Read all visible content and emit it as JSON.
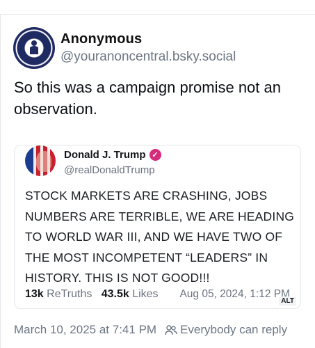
{
  "post": {
    "author_name": "Anonymous",
    "author_handle": "@youranoncentral.bsky.social",
    "text": "So this was a campaign promise not an observation."
  },
  "quote": {
    "author_name": "Donald J. Trump",
    "author_handle": "@realDonaldTrump",
    "text": "STOCK MARKETS ARE CRASHING, JOBS NUMBERS ARE TERRIBLE, WE ARE HEADING TO WORLD WAR III, AND WE HAVE TWO OF THE MOST INCOMPETENT “LEADERS” IN HISTORY. THIS IS NOT GOOD!!!",
    "retruths_count": "13k",
    "retruths_label": "ReTruths",
    "likes_count": "43.5k",
    "likes_label": "Likes",
    "date": "Aug 05, 2024, 1:12 PM",
    "alt_badge": "ALT"
  },
  "footer": {
    "timestamp": "March 10, 2025 at 7:41 PM",
    "reply_setting": "Everybody can reply"
  },
  "colors": {
    "verified_badge": "#d72b7c",
    "muted_text": "#6b7684",
    "avatar_blue": "#1f2a63"
  },
  "icons": {
    "verified": "verified-check-icon",
    "reply_setting": "people-icon"
  }
}
